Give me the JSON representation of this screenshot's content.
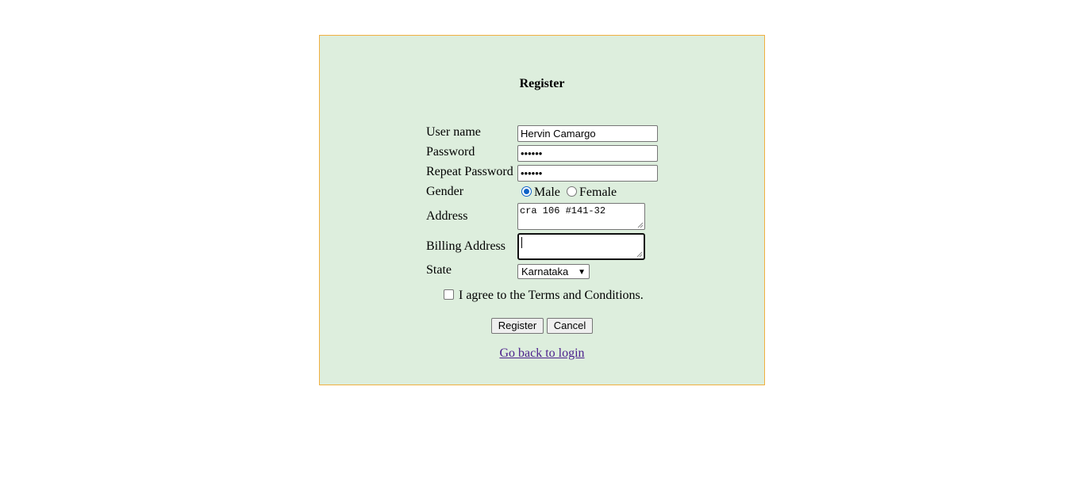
{
  "form": {
    "title": "Register",
    "fields": {
      "username": {
        "label": "User name",
        "value": "Hervin Camargo"
      },
      "password": {
        "label": "Password",
        "value": "••••••"
      },
      "repeat_password": {
        "label": "Repeat Password",
        "value": "••••••"
      },
      "gender": {
        "label": "Gender",
        "options": [
          "Male",
          "Female"
        ],
        "selected": "Male"
      },
      "address": {
        "label": "Address",
        "value": "cra 106 #141-32"
      },
      "billing_address": {
        "label": "Billing Address",
        "value": ""
      },
      "state": {
        "label": "State",
        "selected": "Karnataka"
      }
    },
    "terms_label": "I agree to the Terms and Conditions.",
    "terms_checked": false,
    "register_button": "Register",
    "cancel_button": "Cancel",
    "back_link": "Go back to login"
  },
  "colors": {
    "panel_background": "#ddeedd",
    "panel_border": "#f0b040",
    "link": "#4b1e8c",
    "radio_accent": "#0f62c7"
  }
}
